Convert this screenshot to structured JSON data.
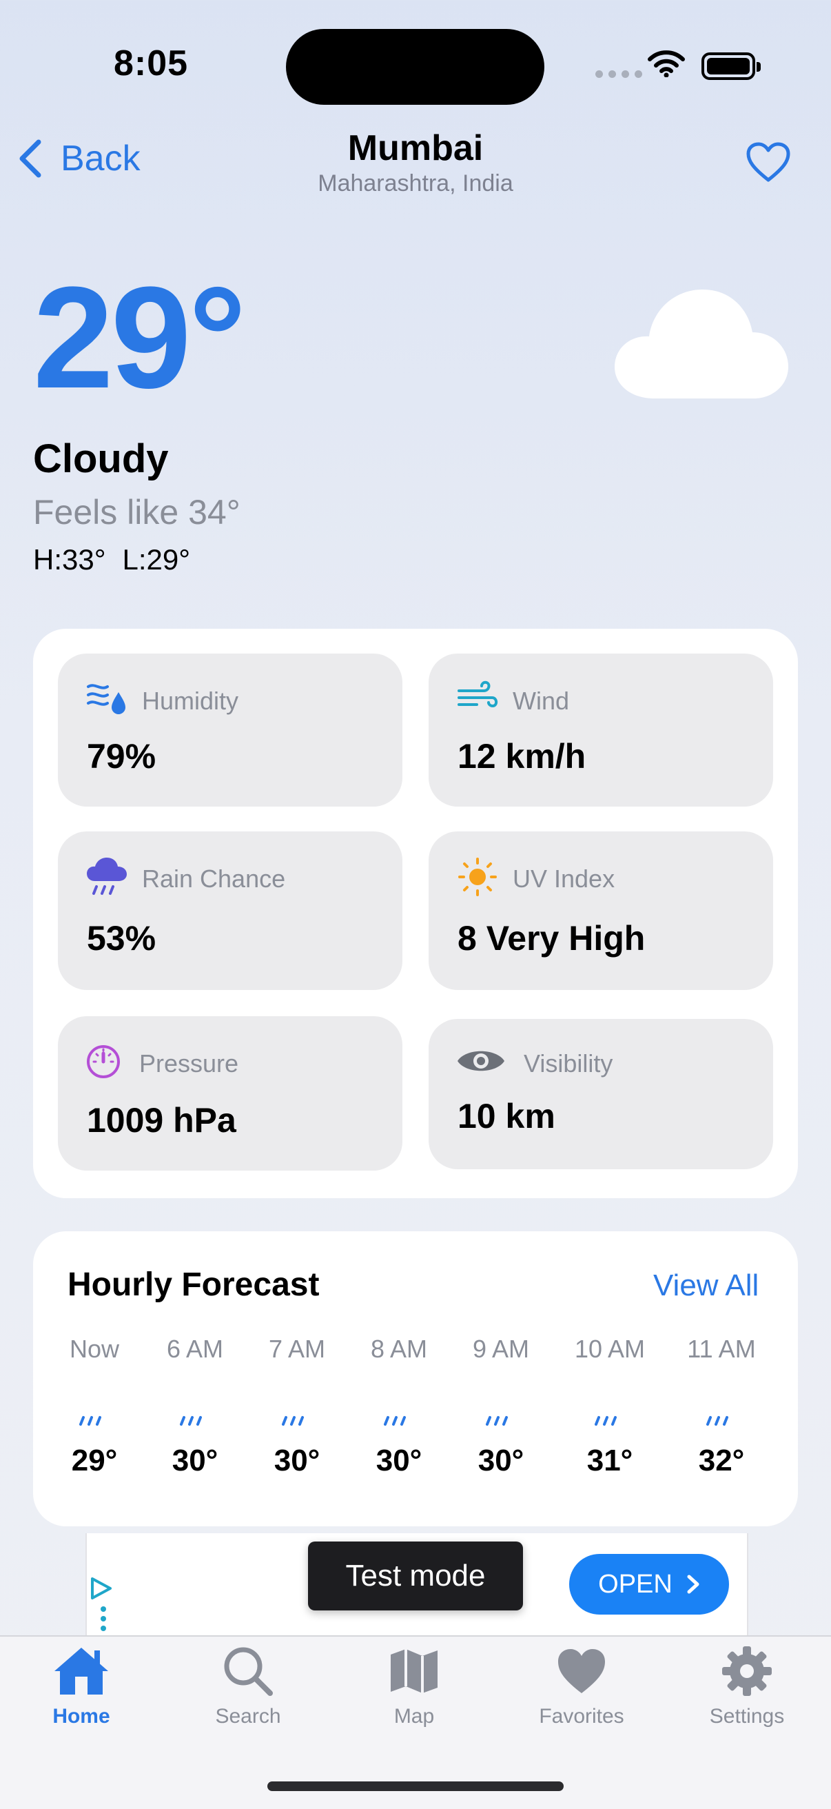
{
  "status": {
    "time": "8:05"
  },
  "header": {
    "back_label": "Back",
    "city": "Mumbai",
    "region": "Maharashtra, India"
  },
  "current": {
    "temperature": "29°",
    "condition": "Cloudy",
    "feels_like": "Feels like 34°",
    "high": "H:33°",
    "low": "L:29°"
  },
  "metrics": [
    {
      "label": "Humidity",
      "value": "79%",
      "icon": "humidity-icon"
    },
    {
      "label": "Wind",
      "value": "12 km/h",
      "icon": "wind-icon"
    },
    {
      "label": "Rain Chance",
      "value": "53%",
      "icon": "rain-cloud-icon"
    },
    {
      "label": "UV Index",
      "value": "8 Very High",
      "icon": "sun-icon"
    },
    {
      "label": "Pressure",
      "value": "1009 hPa",
      "icon": "gauge-icon"
    },
    {
      "label": "Visibility",
      "value": "10 km",
      "icon": "eye-icon"
    }
  ],
  "hourly": {
    "title": "Hourly Forecast",
    "view_all": "View All",
    "items": [
      {
        "time": "Now",
        "temp": "29°"
      },
      {
        "time": "6 AM",
        "temp": "30°"
      },
      {
        "time": "7 AM",
        "temp": "30°"
      },
      {
        "time": "8 AM",
        "temp": "30°"
      },
      {
        "time": "9 AM",
        "temp": "30°"
      },
      {
        "time": "10 AM",
        "temp": "31°"
      },
      {
        "time": "11 AM",
        "temp": "32°"
      }
    ]
  },
  "ad": {
    "test_mode": "Test mode",
    "open_label": "OPEN"
  },
  "tabs": [
    {
      "label": "Home",
      "icon": "house-icon"
    },
    {
      "label": "Search",
      "icon": "magnifier-icon"
    },
    {
      "label": "Map",
      "icon": "map-icon"
    },
    {
      "label": "Favorites",
      "icon": "heart-icon"
    },
    {
      "label": "Settings",
      "icon": "gear-icon"
    }
  ],
  "colors": {
    "accent": "#2a78e4",
    "ad_button": "#1a82f5"
  }
}
